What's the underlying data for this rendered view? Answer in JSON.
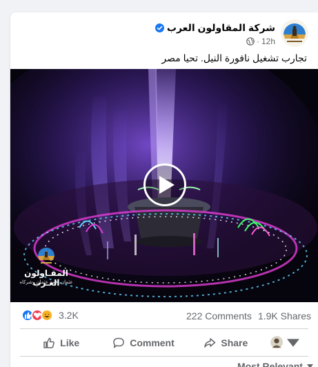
{
  "post": {
    "page_name": "شركة المقاولون العرب",
    "time": "12h",
    "dot": "·",
    "text": "تجارب تشغيل نافورة النيل. تحيا مصر",
    "video": {
      "logo_title": "المقـاولون العـرب",
      "logo_subtitle": "عثمان أحمد عثمان وشركاه"
    }
  },
  "stats": {
    "reaction_count": "3.2K",
    "comments": "222 Comments",
    "shares": "1.9K Shares"
  },
  "actions": {
    "like": "Like",
    "comment": "Comment",
    "share": "Share"
  },
  "comments_sort": {
    "selected": "Most Relevant"
  },
  "colors": {
    "brand_blue": "#1877f2",
    "love_red": "#f33e58",
    "haha_yellow": "#f7b125",
    "text_secondary": "#65676b"
  }
}
